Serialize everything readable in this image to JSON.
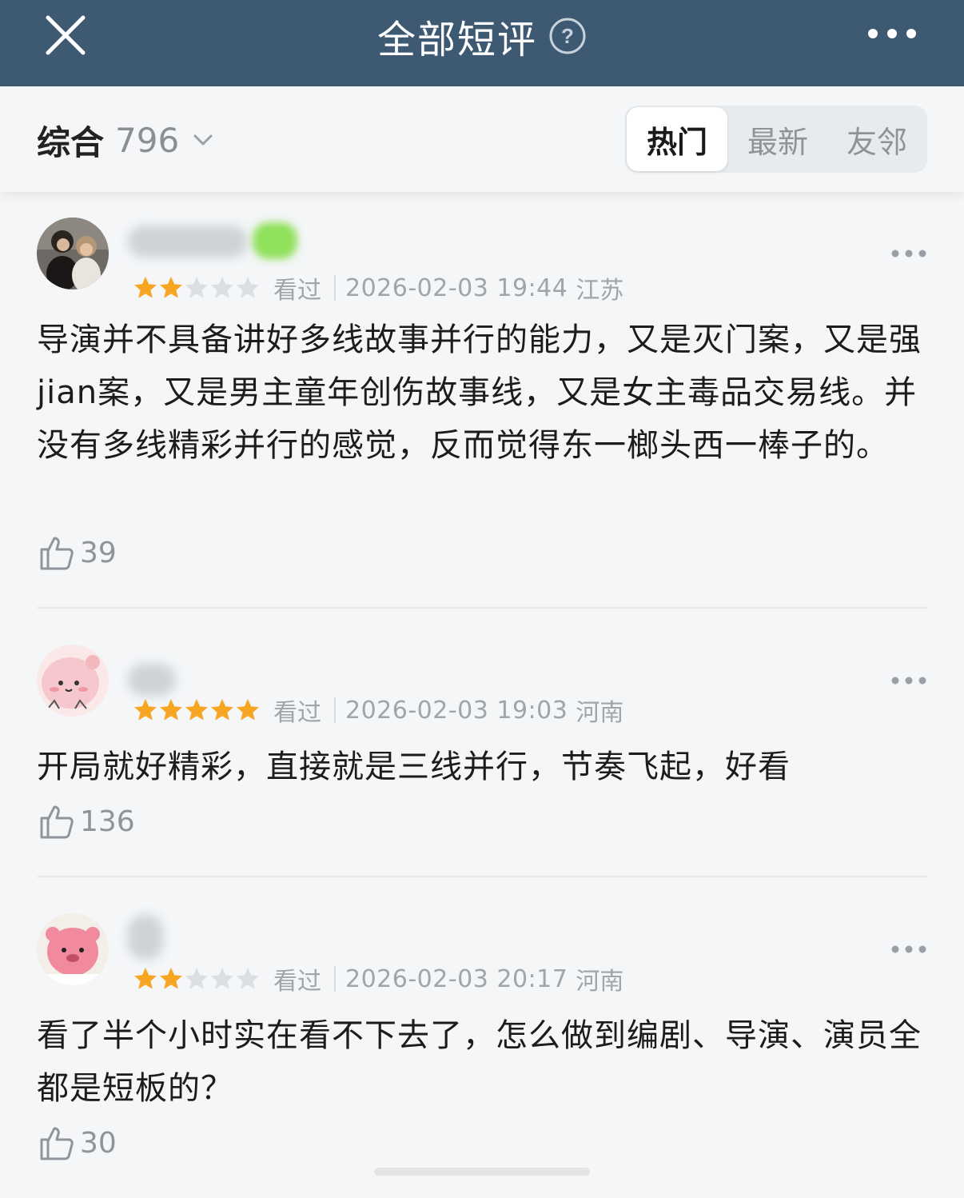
{
  "header": {
    "title": "全部短评",
    "close_icon": "close-icon",
    "help_icon": "question-circle-icon",
    "more_icon": "more-dots-icon",
    "background": "#3e5a73"
  },
  "filter": {
    "sort_label": "综合",
    "sort_count": "796",
    "tabs": [
      {
        "label": "热门",
        "active": true
      },
      {
        "label": "最新",
        "active": false
      },
      {
        "label": "友邻",
        "active": false
      }
    ]
  },
  "comments": [
    {
      "rating": 2,
      "status": "看过",
      "time": "2026-02-03 19:44",
      "location": "江苏",
      "text": "导演并不具备讲好多线故事并行的能力，又是灭门案，又是强jian案，又是男主童年创伤故事线，又是女主毒品交易线。并没有多线精彩并行的感觉，反而觉得东一榔头西一棒子的。",
      "likes": "39"
    },
    {
      "rating": 5,
      "status": "看过",
      "time": "2026-02-03 19:03",
      "location": "河南",
      "text": "开局就好精彩，直接就是三线并行，节奏飞起，好看",
      "likes": "136"
    },
    {
      "rating": 2,
      "status": "看过",
      "time": "2026-02-03 20:17",
      "location": "河南",
      "text": "看了半个小时实在看不下去了，怎么做到编剧、导演、演员全都是短板的？",
      "likes": "30"
    }
  ],
  "colors": {
    "star_on": "#f5a623",
    "star_off": "#dcdfe2",
    "meta_text": "#a0a5aa"
  }
}
